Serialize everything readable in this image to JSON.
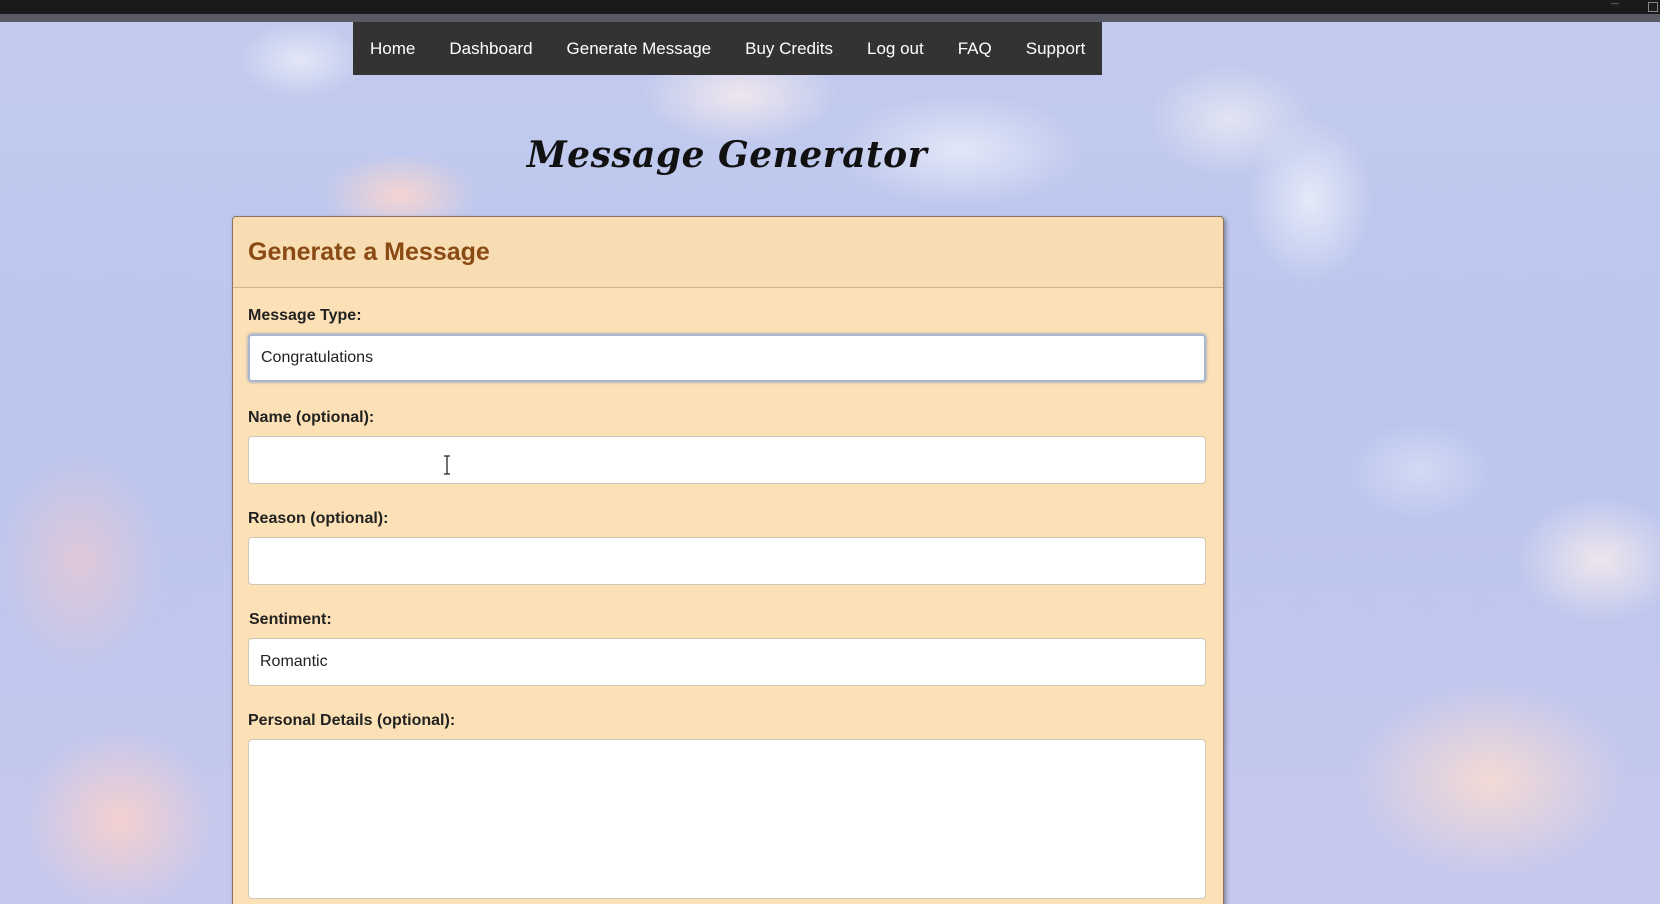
{
  "nav": {
    "items": [
      {
        "label": "Home"
      },
      {
        "label": "Dashboard"
      },
      {
        "label": "Generate Message"
      },
      {
        "label": "Buy Credits"
      },
      {
        "label": "Log out"
      },
      {
        "label": "FAQ"
      },
      {
        "label": "Support"
      }
    ]
  },
  "site": {
    "title": "Message Generator"
  },
  "form": {
    "heading": "Generate a Message",
    "message_type": {
      "label": "Message Type:",
      "value": "Congratulations"
    },
    "name": {
      "label": "Name (optional):",
      "value": ""
    },
    "reason": {
      "label": "Reason (optional):",
      "value": ""
    },
    "sentiment": {
      "label": "Sentiment:",
      "value": "Romantic"
    },
    "personal_details": {
      "label": "Personal Details (optional):",
      "value": ""
    }
  },
  "colors": {
    "nav_bg": "#333333",
    "card_bg": "#fce1b6",
    "heading": "#8a4a14",
    "focus_ring": "#a9b7cf"
  },
  "icons": {
    "cursor": "text-cursor-icon",
    "minimize": "minimize-icon",
    "maximize": "maximize-icon"
  }
}
